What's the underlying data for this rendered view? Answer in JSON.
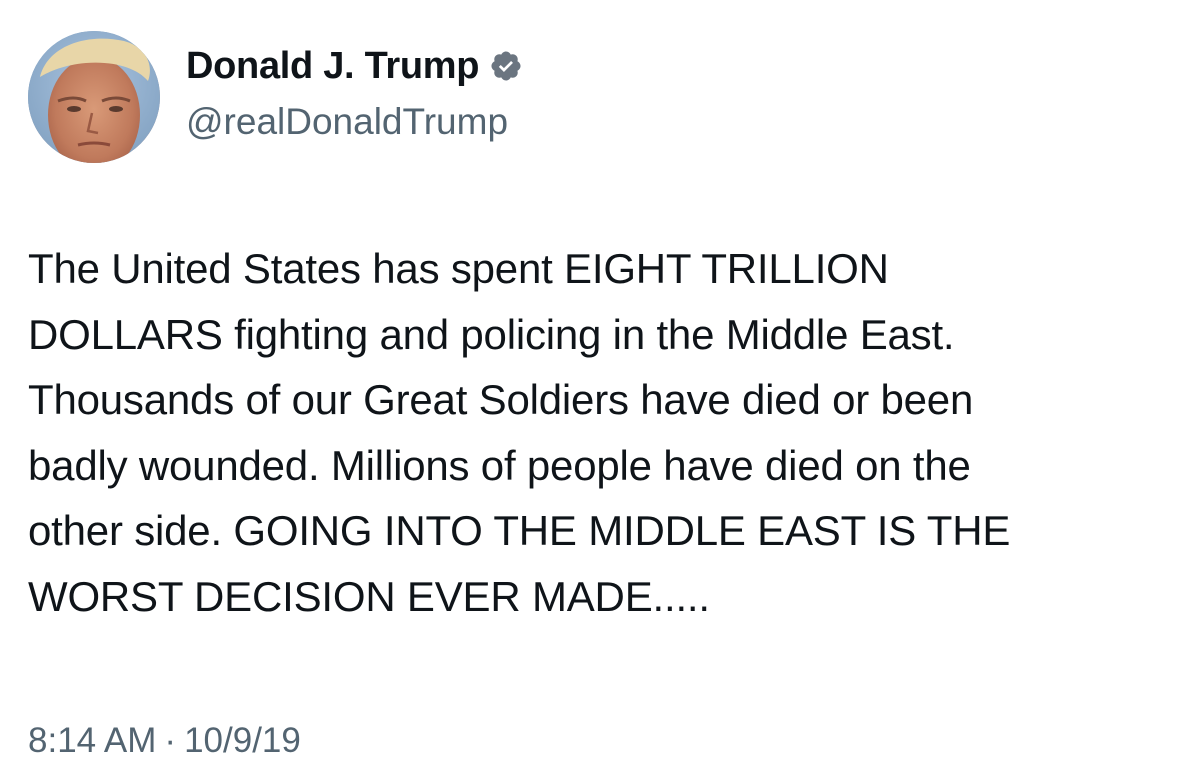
{
  "author": {
    "display_name": "Donald J. Trump",
    "handle": "@realDonaldTrump",
    "verified_icon": "verified-badge-icon",
    "verified_color": "#1d9bf0"
  },
  "tweet": {
    "text": "The United States has spent EIGHT TRILLION\nDOLLARS fighting and policing in the Middle East.\nThousands of our Great Soldiers have died or been\nbadly wounded. Millions of people have died on the\nother side. GOING INTO THE MIDDLE EAST IS THE\nWORST DECISION EVER MADE.....",
    "time": "8:14 AM",
    "separator": "·",
    "date": "10/9/19"
  }
}
